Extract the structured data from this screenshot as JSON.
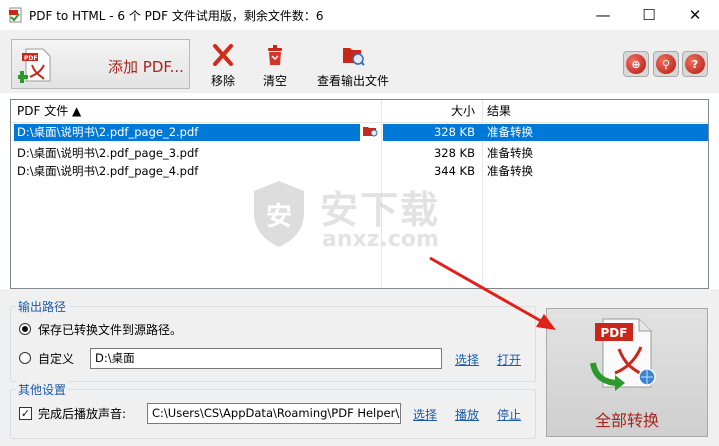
{
  "window": {
    "title": "PDF to HTML - 6 个 PDF 文件试用版，剩余文件数：6",
    "controls": {
      "minimize": "—",
      "maximize": "☐",
      "close": "✕"
    }
  },
  "toolbar": {
    "add_pdf": "添加 PDF...",
    "remove": "移除",
    "clear": "清空",
    "view_output": "查看输出文件",
    "right_icons": [
      "globe-icon",
      "tools-icon",
      "help-icon"
    ]
  },
  "file_list": {
    "columns": {
      "file": "PDF 文件 ▲",
      "size": "大小",
      "result": "结果"
    },
    "rows": [
      {
        "file": "D:\\桌面\\说明书\\2.pdf_page_2.pdf",
        "size": "328 KB",
        "result": "准备转换",
        "selected": true
      },
      {
        "file": "D:\\桌面\\说明书\\2.pdf_page_3.pdf",
        "size": "328 KB",
        "result": "准备转换",
        "selected": false
      },
      {
        "file": "D:\\桌面\\说明书\\2.pdf_page_4.pdf",
        "size": "344 KB",
        "result": "准备转换",
        "selected": false
      }
    ]
  },
  "watermark": {
    "cn": "安下载",
    "en": "anxz.com",
    "shield": "安"
  },
  "output_path": {
    "legend": "输出路径",
    "option_source": "保存已转换文件到源路径。",
    "option_custom": "自定义",
    "custom_value": "D:\\桌面",
    "browse": "选择",
    "open": "打开",
    "selected_option": "source"
  },
  "other_settings": {
    "legend": "其他设置",
    "sound_label": "完成后播放声音:",
    "sound_checked": true,
    "sound_path": "C:\\Users\\CS\\AppData\\Roaming\\PDF Helper\\PD",
    "browse": "选择",
    "play": "播放",
    "stop": "停止"
  },
  "convert_button": {
    "label": "全部转换",
    "badge": "PDF"
  },
  "colors": {
    "accent_red": "#a6261b",
    "selection": "#0078d7",
    "link": "#1a5ca8",
    "arrow": "#e0201b"
  }
}
